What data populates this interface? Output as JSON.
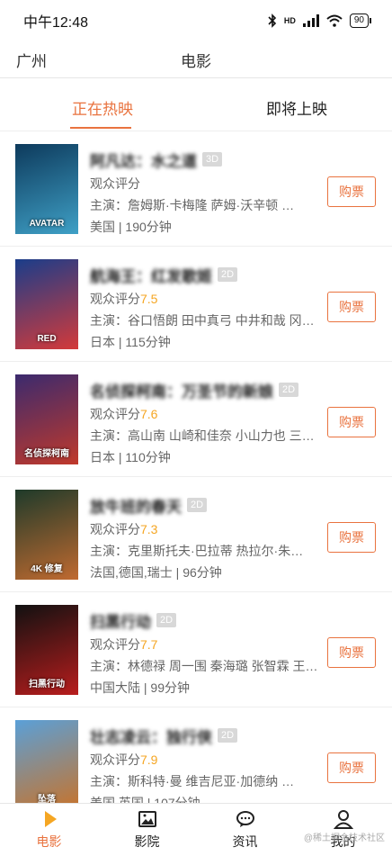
{
  "status_bar": {
    "time": "中午12:48",
    "network_label": "HD",
    "battery": "90"
  },
  "header": {
    "city": "广州",
    "title": "电影"
  },
  "tabs": [
    {
      "label": "正在热映",
      "active": true
    },
    {
      "label": "即将上映",
      "active": false
    }
  ],
  "movies": [
    {
      "title": "阿凡达：水之道",
      "format": "3D",
      "rating_label": "观众评分",
      "rating": "",
      "cast": "主演：詹姆斯·卡梅隆 萨姆·沃辛顿 …",
      "meta": "美国 | 190分钟",
      "buy_label": "购票",
      "poster_text": "AVATAR",
      "poster_colors": [
        "#0d3a5c",
        "#3fa0c6"
      ]
    },
    {
      "title": "航海王：红发歌姬",
      "format": "2D",
      "rating_label": "观众评分",
      "rating": "7.5",
      "cast": "主演：谷口悟朗 田中真弓 中井和哉 冈…",
      "meta": "日本 | 115分钟",
      "buy_label": "购票",
      "poster_text": "RED",
      "poster_colors": [
        "#1a3d8a",
        "#d43a3a"
      ]
    },
    {
      "title": "名侦探柯南：万圣节的新娘",
      "format": "2D",
      "rating_label": "观众评分",
      "rating": "7.6",
      "cast": "主演：高山南 山崎和佳奈 小山力也 三…",
      "meta": "日本 | 110分钟",
      "buy_label": "购票",
      "poster_text": "名侦探柯南",
      "poster_colors": [
        "#3b2a6e",
        "#c0392b"
      ]
    },
    {
      "title": "放牛班的春天",
      "format": "2D",
      "rating_label": "观众评分",
      "rating": "7.3",
      "cast": "主演：克里斯托夫·巴拉蒂 热拉尔·朱…",
      "meta": "法国,德国,瑞士 | 96分钟",
      "buy_label": "购票",
      "poster_text": "4K 修复",
      "poster_colors": [
        "#1e3a2a",
        "#c06a30"
      ]
    },
    {
      "title": "扫黑行动",
      "format": "2D",
      "rating_label": "观众评分",
      "rating": "7.7",
      "cast": "主演：林德禄 周一围 秦海璐 张智霖 王…",
      "meta": "中国大陆 | 99分钟",
      "buy_label": "购票",
      "poster_text": "扫黑行动",
      "poster_colors": [
        "#111111",
        "#b81d1d"
      ]
    },
    {
      "title": "壮志凌云：独行侠",
      "format": "2D",
      "rating_label": "观众评分",
      "rating": "7.9",
      "cast": "主演：斯科特·曼 维吉尼亚·加德纳 …",
      "meta": "美国,英国 | 107分钟",
      "buy_label": "购票",
      "poster_text": "坠落",
      "poster_colors": [
        "#5aa0d8",
        "#c8732a"
      ]
    }
  ],
  "bottom_nav": [
    {
      "label": "电影",
      "icon": "play-icon",
      "active": true
    },
    {
      "label": "影院",
      "icon": "image-icon",
      "active": false
    },
    {
      "label": "资讯",
      "icon": "chat-icon",
      "active": false
    },
    {
      "label": "我的",
      "icon": "user-icon",
      "active": false
    }
  ],
  "watermark": "@稀土掘金技术社区",
  "colors": {
    "accent": "#e9733f",
    "rating": "#f5a623",
    "badge": "#d8d8d8"
  }
}
